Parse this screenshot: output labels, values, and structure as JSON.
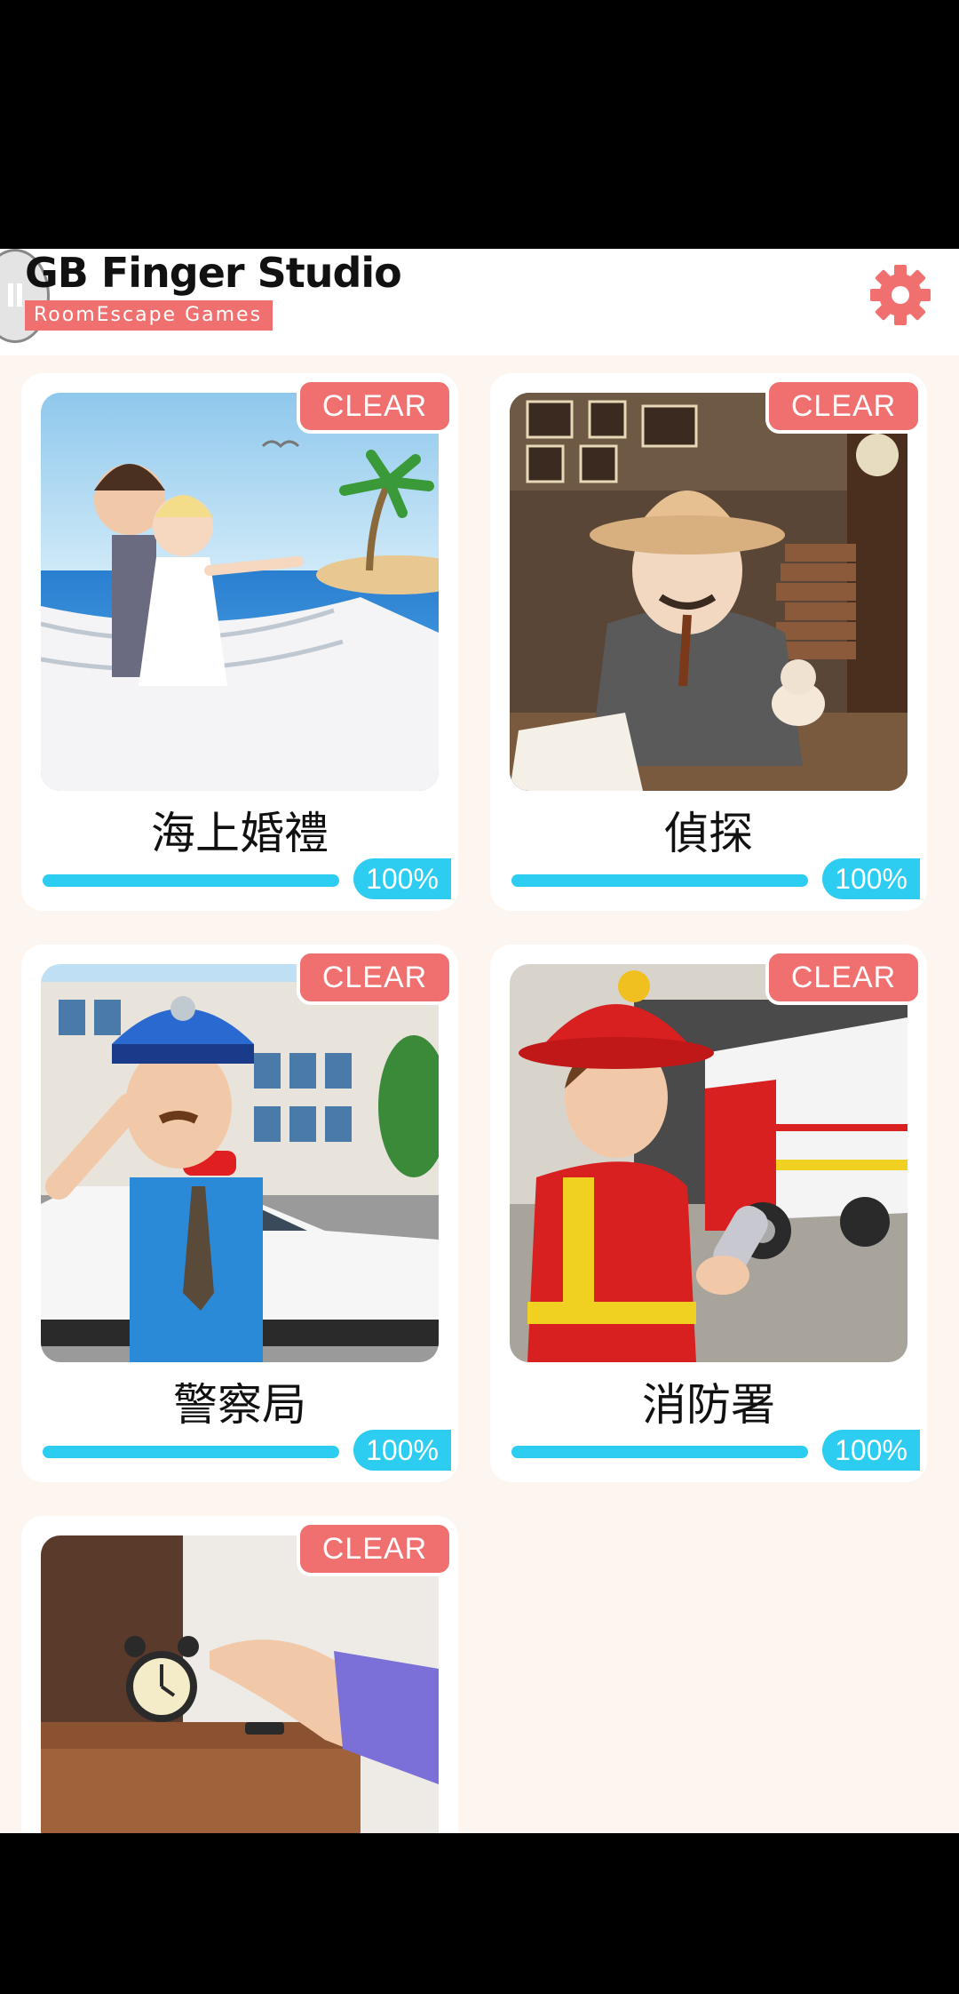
{
  "header": {
    "title": "GB Finger Studio",
    "subtitle": "RoomEscape  Games",
    "back_icon": "back-icon",
    "settings_icon": "gear-icon"
  },
  "colors": {
    "accent_red": "#f06f6f",
    "progress_cyan": "#2ccdf0",
    "background": "#fdf6f0"
  },
  "stages": [
    {
      "title": "海上婚禮",
      "status": "CLEAR",
      "progress_label": "100%",
      "progress": 1.0
    },
    {
      "title": "偵探",
      "status": "CLEAR",
      "progress_label": "100%",
      "progress": 1.0
    },
    {
      "title": "警察局",
      "status": "CLEAR",
      "progress_label": "100%",
      "progress": 1.0
    },
    {
      "title": "消防署",
      "status": "CLEAR",
      "progress_label": "100%",
      "progress": 1.0
    },
    {
      "title": "",
      "status": "CLEAR",
      "progress_label": "",
      "progress": null
    }
  ]
}
